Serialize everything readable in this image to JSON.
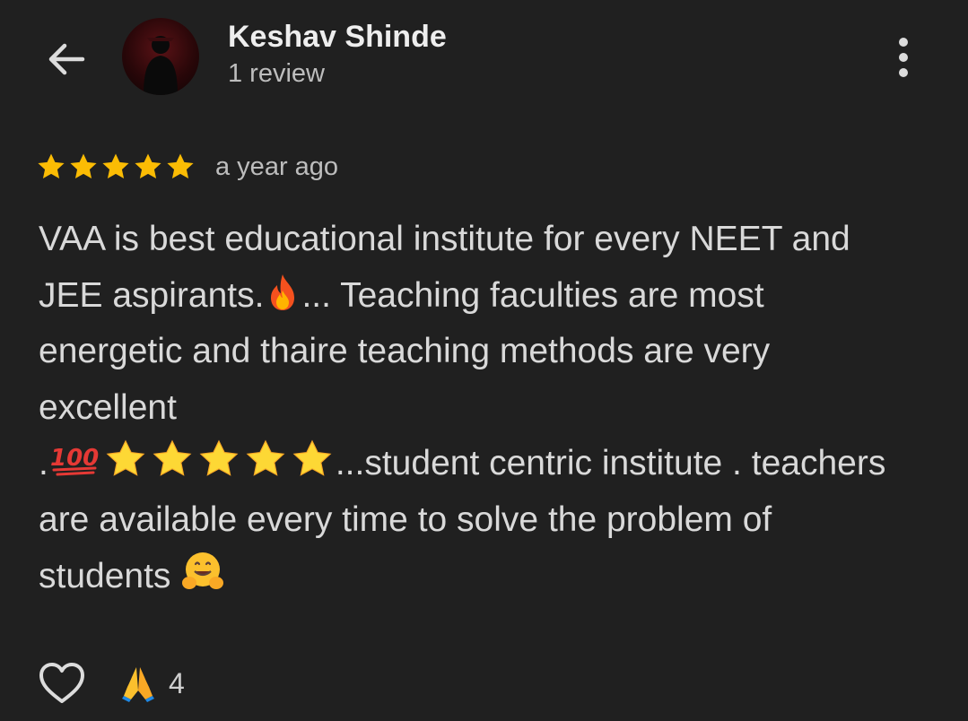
{
  "header": {
    "back_icon": "arrow-left-icon",
    "avatar_icon": "profile-photo",
    "reviewer_name": "Keshav Shinde",
    "review_count": "1 review",
    "more_icon": "more-vert-icon"
  },
  "review": {
    "rating": 5,
    "rating_max": 5,
    "star_color": "#fbbc04",
    "timestamp": "a year ago",
    "lines": [
      "VAA is best educational institute for every NEET and",
      "JEE aspirants.",
      "... Teaching faculties are most",
      "energetic and thaire teaching methods are very",
      "excellent",
      ".",
      "...student centric institute . teachers",
      "are available every time to solve the problem of",
      "students"
    ],
    "emojis": [
      "fire-emoji",
      "hundred-points-emoji",
      "star-emoji",
      "hugging-face-emoji"
    ]
  },
  "actions": {
    "like_icon": "heart-outline-icon",
    "reaction_icon": "folded-hands-emoji",
    "reaction_count": "4"
  }
}
